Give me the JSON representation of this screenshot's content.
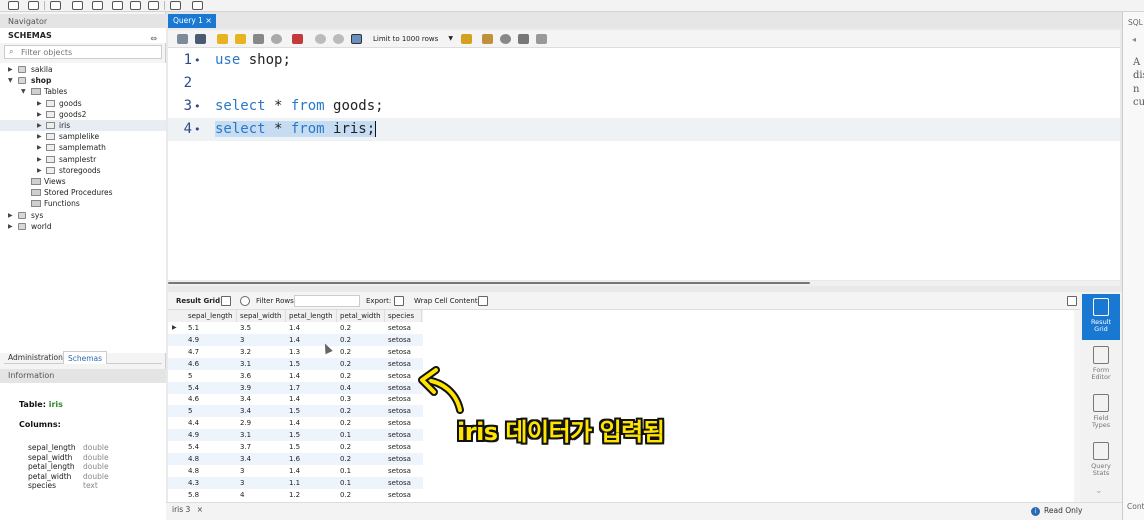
{
  "navigator": {
    "title": "Navigator",
    "schemas_label": "SCHEMAS",
    "filter_placeholder": "Filter objects",
    "tree": [
      {
        "label": "sakila",
        "level": 0,
        "type": "db",
        "expanded": false
      },
      {
        "label": "shop",
        "level": 0,
        "type": "db",
        "expanded": true,
        "bold": true
      },
      {
        "label": "Tables",
        "level": 1,
        "type": "folder",
        "expanded": true
      },
      {
        "label": "goods",
        "level": 2,
        "type": "table",
        "expanded": false
      },
      {
        "label": "goods2",
        "level": 2,
        "type": "table",
        "expanded": false
      },
      {
        "label": "iris",
        "level": 2,
        "type": "table",
        "expanded": false,
        "selected": true
      },
      {
        "label": "samplelike",
        "level": 2,
        "type": "table",
        "expanded": false
      },
      {
        "label": "samplemath",
        "level": 2,
        "type": "table",
        "expanded": false
      },
      {
        "label": "samplestr",
        "level": 2,
        "type": "table",
        "expanded": false
      },
      {
        "label": "storegoods",
        "level": 2,
        "type": "table",
        "expanded": false
      },
      {
        "label": "Views",
        "level": 1,
        "type": "folder",
        "expanded": null
      },
      {
        "label": "Stored Procedures",
        "level": 1,
        "type": "folder",
        "expanded": null
      },
      {
        "label": "Functions",
        "level": 1,
        "type": "folder",
        "expanded": null
      },
      {
        "label": "sys",
        "level": 0,
        "type": "db",
        "expanded": false
      },
      {
        "label": "world",
        "level": 0,
        "type": "db",
        "expanded": false
      }
    ],
    "tabs": [
      "Administration",
      "Schemas"
    ],
    "info_title": "Information",
    "info": {
      "table_label": "Table:",
      "table_name": "iris",
      "columns_label": "Columns:",
      "columns": [
        {
          "name": "sepal_length",
          "type": "double"
        },
        {
          "name": "sepal_width",
          "type": "double"
        },
        {
          "name": "petal_length",
          "type": "double"
        },
        {
          "name": "petal_width",
          "type": "double"
        },
        {
          "name": "species",
          "type": "text"
        }
      ]
    }
  },
  "editor": {
    "tab_label": "Query 1",
    "limit_label": "Limit to 1000 rows",
    "lines": [
      {
        "n": "1",
        "dot": "•",
        "tokens": [
          {
            "t": "use",
            "kw": true
          },
          {
            "t": " shop;",
            "kw": false
          }
        ],
        "selected": false
      },
      {
        "n": "2",
        "dot": "",
        "tokens": [],
        "selected": false
      },
      {
        "n": "3",
        "dot": "•",
        "tokens": [
          {
            "t": "select",
            "kw": true
          },
          {
            "t": " * ",
            "kw": false
          },
          {
            "t": "from",
            "kw": true
          },
          {
            "t": " goods;",
            "kw": false
          }
        ],
        "selected": false
      },
      {
        "n": "4",
        "dot": "•",
        "tokens": [
          {
            "t": "select",
            "kw": true
          },
          {
            "t": " * ",
            "kw": false
          },
          {
            "t": "from",
            "kw": true
          },
          {
            "t": " iris;",
            "kw": false
          }
        ],
        "selected": true
      }
    ]
  },
  "results": {
    "result_grid_label": "Result Grid",
    "filter_rows_label": "Filter Rows:",
    "export_label": "Export:",
    "wrap_label": "Wrap Cell Content:",
    "columns": [
      "sepal_length",
      "sepal_width",
      "petal_length",
      "petal_width",
      "species"
    ],
    "rows": [
      [
        "5.1",
        "3.5",
        "1.4",
        "0.2",
        "setosa"
      ],
      [
        "4.9",
        "3",
        "1.4",
        "0.2",
        "setosa"
      ],
      [
        "4.7",
        "3.2",
        "1.3",
        "0.2",
        "setosa"
      ],
      [
        "4.6",
        "3.1",
        "1.5",
        "0.2",
        "setosa"
      ],
      [
        "5",
        "3.6",
        "1.4",
        "0.2",
        "setosa"
      ],
      [
        "5.4",
        "3.9",
        "1.7",
        "0.4",
        "setosa"
      ],
      [
        "4.6",
        "3.4",
        "1.4",
        "0.3",
        "setosa"
      ],
      [
        "5",
        "3.4",
        "1.5",
        "0.2",
        "setosa"
      ],
      [
        "4.4",
        "2.9",
        "1.4",
        "0.2",
        "setosa"
      ],
      [
        "4.9",
        "3.1",
        "1.5",
        "0.1",
        "setosa"
      ],
      [
        "5.4",
        "3.7",
        "1.5",
        "0.2",
        "setosa"
      ],
      [
        "4.8",
        "3.4",
        "1.6",
        "0.2",
        "setosa"
      ],
      [
        "4.8",
        "3",
        "1.4",
        "0.1",
        "setosa"
      ],
      [
        "4.3",
        "3",
        "1.1",
        "0.1",
        "setosa"
      ],
      [
        "5.8",
        "4",
        "1.2",
        "0.2",
        "setosa"
      ]
    ],
    "side_buttons": [
      {
        "line1": "Result",
        "line2": "Grid",
        "active": true
      },
      {
        "line1": "Form",
        "line2": "Editor",
        "active": false
      },
      {
        "line1": "Field",
        "line2": "Types",
        "active": false
      },
      {
        "line1": "Query",
        "line2": "Stats",
        "active": false
      }
    ]
  },
  "status": {
    "result_tab": "iris 3",
    "close": "×",
    "read_only": "Read Only"
  },
  "sql_panel": {
    "header": "SQL",
    "footer": "Cont",
    "text": [
      "A",
      "dis",
      "n",
      "cu"
    ]
  },
  "annotation": {
    "text": "iris 데이터가 입력됨",
    "color": "#ffe400"
  },
  "colors": {
    "accent": "#1978d2",
    "keyword": "#2a78c8",
    "selection": "#c6dcf3",
    "row_alt": "#eef4fb"
  }
}
